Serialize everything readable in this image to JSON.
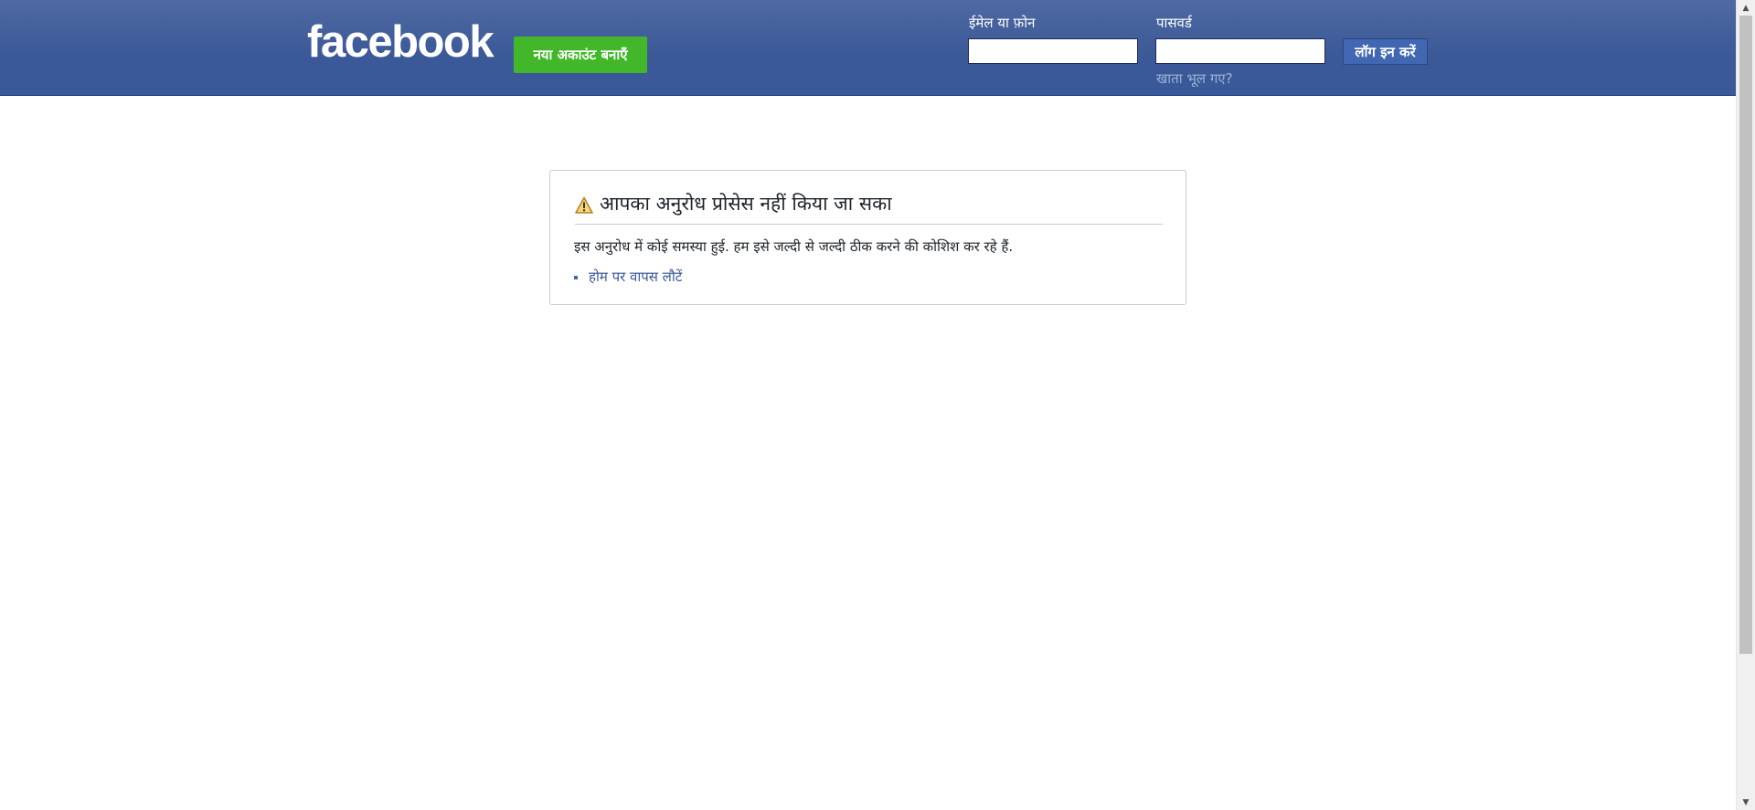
{
  "header": {
    "logo_text": "facebook",
    "signup_label": "नया अकाउंट बनाएँ",
    "email_label": "ईमेल या फ़ोन",
    "email_value": "",
    "password_label": "पासवर्ड",
    "password_value": "",
    "login_label": "लॉग इन करें",
    "forgot_label": "खाता भूल गए?"
  },
  "error": {
    "title": "आपका अनुरोध प्रोसेस नहीं किया जा सका",
    "message": "इस अनुरोध में कोई समस्या हुई. हम इसे जल्दी से जल्दी ठीक करने की कोशिश कर रहे हैं.",
    "home_link": "होम पर वापस लौटें",
    "icon": "warning-icon"
  },
  "colors": {
    "brand_blue": "#3b5998",
    "signup_green": "#42b72a",
    "link_blue": "#365899"
  }
}
